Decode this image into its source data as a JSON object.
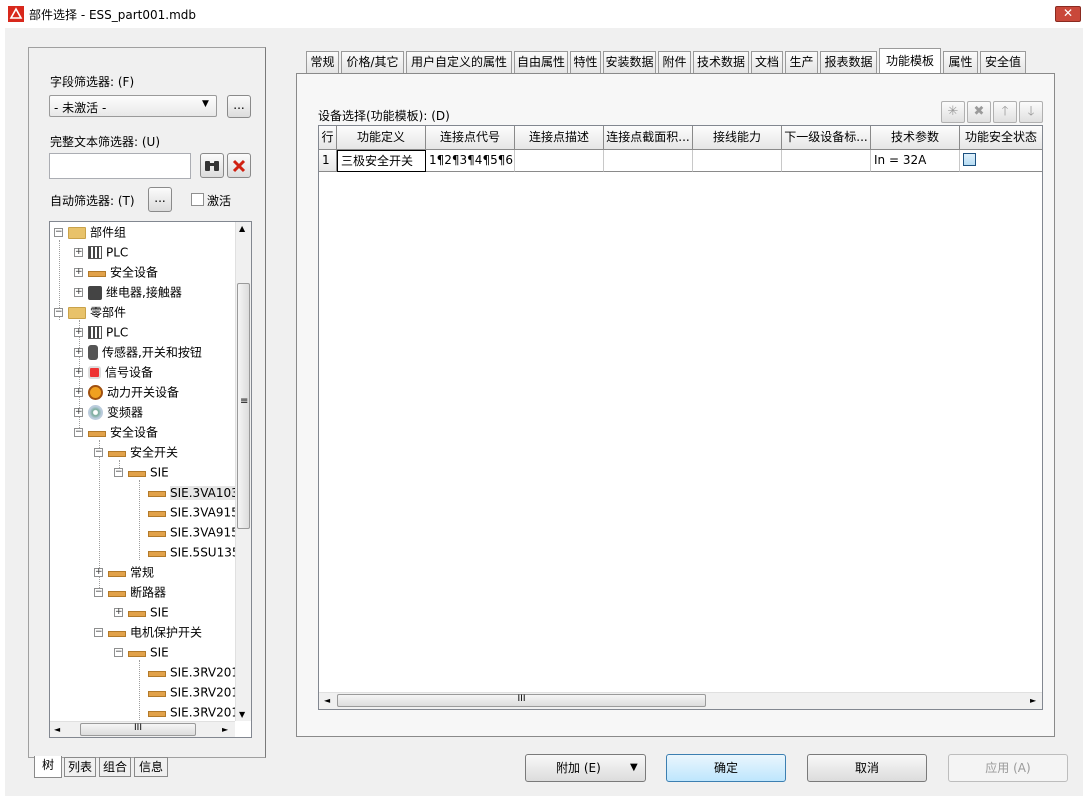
{
  "window": {
    "title": "部件选择 - ESS_part001.mdb",
    "close_glyph": "✕"
  },
  "filters": {
    "field_filter_label": "字段筛选器: (F)",
    "field_filter_value": "- 未激活 -",
    "more_glyph": "...",
    "fulltext_filter_label": "完整文本筛选器: (U)",
    "fulltext_value": "",
    "auto_filter_label": "自动筛选器: (T)",
    "activate_label": "激活"
  },
  "tree": {
    "nodes": [
      {
        "label": "部件组",
        "icon": "folder-icon",
        "expander": "−"
      },
      {
        "label": "PLC",
        "icon": "plc-icon",
        "expander": "+"
      },
      {
        "label": "安全设备",
        "icon": "device-bar-icon",
        "expander": "+"
      },
      {
        "label": "继电器,接触器",
        "icon": "relay-icon",
        "expander": "+"
      },
      {
        "label": "零部件",
        "icon": "folder-icon",
        "expander": "−"
      },
      {
        "label": "PLC",
        "icon": "plc-icon",
        "expander": "+"
      },
      {
        "label": "传感器,开关和按钮",
        "icon": "sensor-icon",
        "expander": "+"
      },
      {
        "label": "信号设备",
        "icon": "signal-icon",
        "expander": "+"
      },
      {
        "label": "动力开关设备",
        "icon": "power-switch-icon",
        "expander": "+"
      },
      {
        "label": "变频器",
        "icon": "inverter-icon",
        "expander": "+"
      },
      {
        "label": "安全设备",
        "icon": "device-bar-icon",
        "expander": "−"
      },
      {
        "label": "安全开关",
        "icon": "device-bar-icon",
        "expander": "−"
      },
      {
        "label": "SIE",
        "icon": "device-bar-icon",
        "expander": "−"
      },
      {
        "label": "SIE.3VA103",
        "icon": "device-bar-icon",
        "expander": ""
      },
      {
        "label": "SIE.3VA915",
        "icon": "device-bar-icon",
        "expander": ""
      },
      {
        "label": "SIE.3VA915",
        "icon": "device-bar-icon",
        "expander": ""
      },
      {
        "label": "SIE.5SU135",
        "icon": "device-bar-icon",
        "expander": ""
      },
      {
        "label": "常规",
        "icon": "device-bar-icon",
        "expander": "+"
      },
      {
        "label": "断路器",
        "icon": "device-bar-icon",
        "expander": "−"
      },
      {
        "label": "SIE",
        "icon": "device-bar-icon",
        "expander": "+"
      },
      {
        "label": "电机保护开关",
        "icon": "device-bar-icon",
        "expander": "−"
      },
      {
        "label": "SIE",
        "icon": "device-bar-icon",
        "expander": "−"
      },
      {
        "label": "SIE.3RV201",
        "icon": "device-bar-icon",
        "expander": ""
      },
      {
        "label": "SIE.3RV201",
        "icon": "device-bar-icon",
        "expander": ""
      },
      {
        "label": "SIE.3RV201",
        "icon": "device-bar-icon",
        "expander": ""
      }
    ],
    "selected_index": 13,
    "hscroll_glyph": "III",
    "vscroll_glyph": "≡"
  },
  "bottom_tabs": [
    "树",
    "列表",
    "组合",
    "信息"
  ],
  "tabs": [
    {
      "label": "常规"
    },
    {
      "label": "价格/其它"
    },
    {
      "label": "用户自定义的属性"
    },
    {
      "label": "自由属性"
    },
    {
      "label": "特性"
    },
    {
      "label": "安装数据"
    },
    {
      "label": "附件"
    },
    {
      "label": "技术数据"
    },
    {
      "label": "文档"
    },
    {
      "label": "生产"
    },
    {
      "label": "报表数据"
    },
    {
      "label": "功能模板"
    },
    {
      "label": "属性"
    },
    {
      "label": "安全值"
    }
  ],
  "active_tab": "功能模板",
  "device_selection": {
    "label": "设备选择(功能模板): (D)",
    "columns": [
      "行",
      "功能定义",
      "连接点代号",
      "连接点描述",
      "连接点截面积...",
      "接线能力",
      "下一级设备标...",
      "技术参数",
      "功能安全状态"
    ],
    "rows": [
      [
        "1",
        "三极安全开关",
        "1¶2¶3¶4¶5¶6",
        "",
        "",
        "",
        "",
        "In = 32A",
        ""
      ]
    ],
    "toolbar_icons": [
      "new-icon",
      "delete-icon",
      "move-up-icon",
      "move-down-icon"
    ],
    "hscroll_glyph": "III"
  },
  "buttons": {
    "append": "附加 (E)",
    "ok": "确定",
    "cancel": "取消",
    "apply": "应用 (A)"
  }
}
